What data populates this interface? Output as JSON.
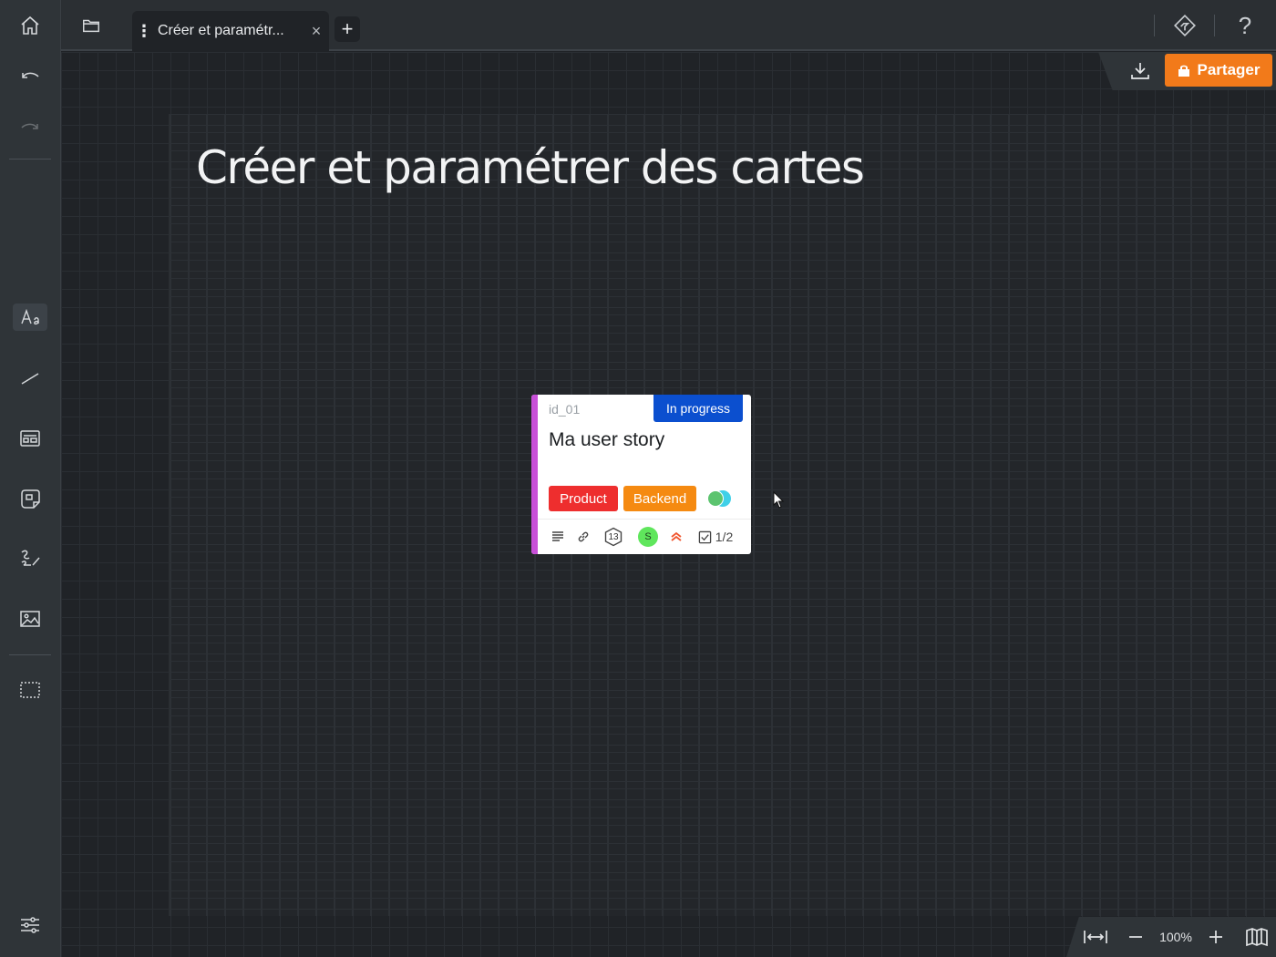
{
  "tab": {
    "label": "Créer et paramétr...",
    "close": "×",
    "add": "+"
  },
  "topbar": {
    "help": "?"
  },
  "actions": {
    "share_label": "Partager"
  },
  "board": {
    "title": "Créer et paramétrer des cartes"
  },
  "card": {
    "id": "id_01",
    "status": "In progress",
    "title": "Ma user story",
    "tags": [
      "Product",
      "Backend"
    ],
    "points": "13",
    "assignee_initial": "S",
    "checklist": "1/2",
    "colors": {
      "stripe": "#c84fd8",
      "status": "#0b4fcf",
      "product": "#ee2e2e",
      "backend": "#f58a11"
    }
  },
  "zoom": {
    "level": "100%"
  },
  "colors": {
    "accent": "#f27a1a",
    "background": "#202327"
  }
}
